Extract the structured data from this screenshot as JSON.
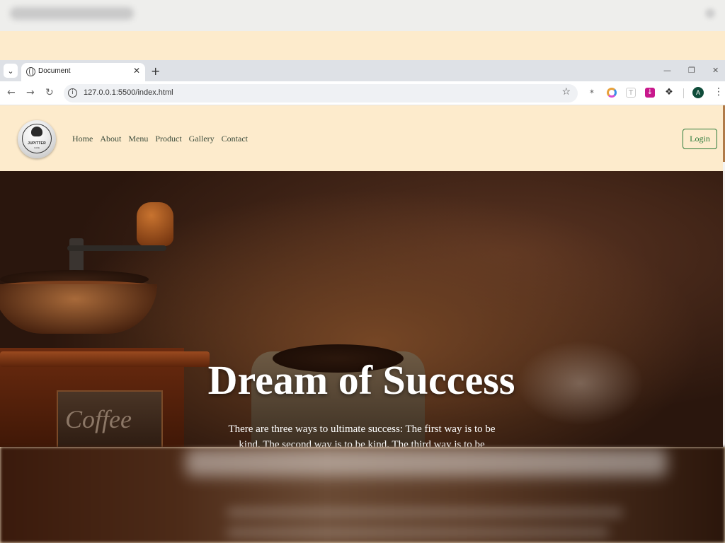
{
  "browser": {
    "tab_title": "Document",
    "url": "127.0.0.1:5500/index.html",
    "profile_initial": "A"
  },
  "icons": {
    "tab_list": "chevron-down-icon",
    "favicon": "globe-icon",
    "close_tab": "close-icon",
    "new_tab": "plus-icon",
    "minimize": "minimize-icon",
    "restore": "restore-icon",
    "close_window": "close-icon",
    "back": "arrow-left-icon",
    "forward": "arrow-right-icon",
    "reload": "reload-icon",
    "site_info": "info-icon",
    "bookmark": "star-icon",
    "extensions": "puzzle-icon",
    "menu": "more-vertical-icon"
  },
  "site": {
    "logo_text": "JUPITTER",
    "logo_subtext": "CAFE",
    "nav": [
      "Home",
      "About",
      "Menu",
      "Product",
      "Gallery",
      "Contact"
    ],
    "login_label": "Login",
    "hero_title": "Dream of Success",
    "hero_text": "There are three ways to ultimate success: The first way is to be kind. The second way is to be kind. The third way is to be"
  },
  "colors": {
    "header_bg": "#fdebcc",
    "login_accent": "#2c7a3a",
    "nav_text": "#3b4b3b"
  }
}
